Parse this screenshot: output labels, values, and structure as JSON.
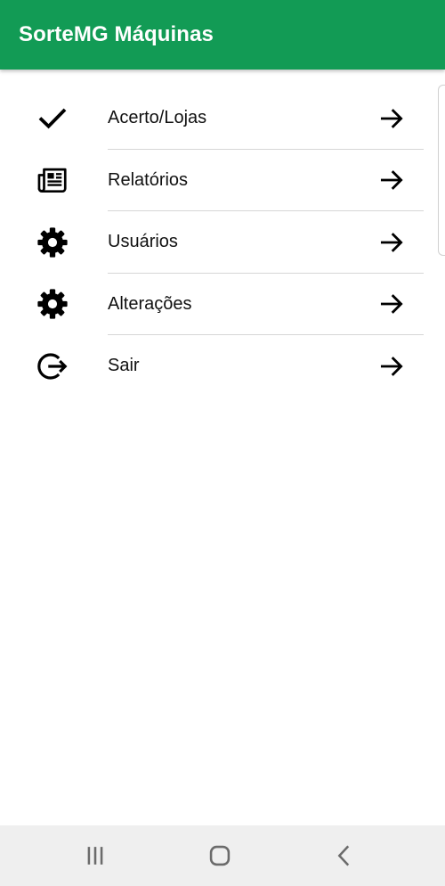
{
  "app": {
    "title": "SorteMG Máquinas",
    "accent": "#129b55"
  },
  "menu": {
    "items": [
      {
        "label": "Acerto/Lojas",
        "icon": "check-icon"
      },
      {
        "label": "Relatórios",
        "icon": "newspaper-icon"
      },
      {
        "label": "Usuários",
        "icon": "gear-icon"
      },
      {
        "label": "Alterações",
        "icon": "gear-icon"
      },
      {
        "label": "Sair",
        "icon": "logout-icon"
      }
    ],
    "arrow_icon": "arrow-right-icon"
  },
  "navbar": {
    "buttons": [
      "recent-apps-icon",
      "home-icon",
      "back-icon"
    ]
  }
}
